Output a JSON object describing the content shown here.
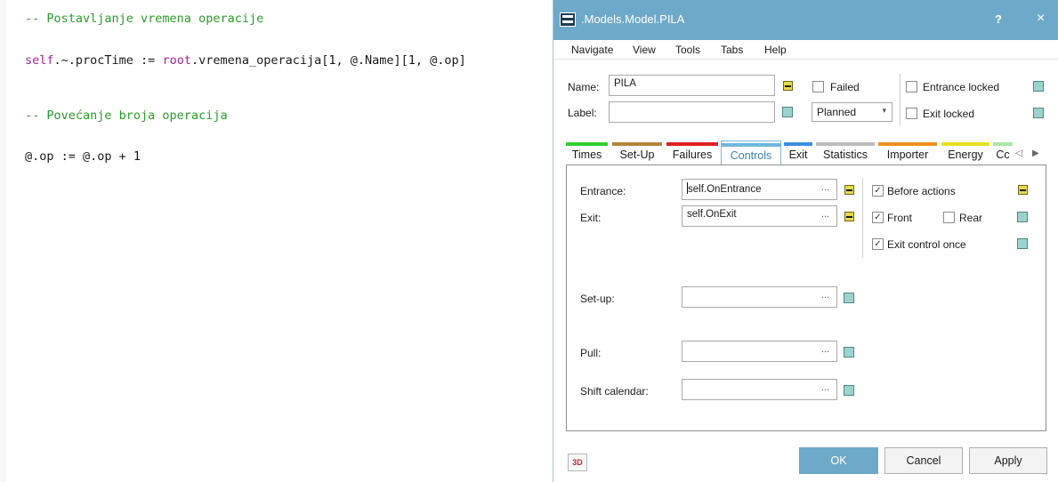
{
  "editor": {
    "lines": [
      {
        "text": "-- Postavljanje vremena operacije"
      },
      {
        "kw1": "self",
        "p1": ".~.procTime := ",
        "kw2": "root",
        "p2": ".vremena_operacija[1, @.Name][1, @.op]"
      },
      {
        "text": "-- Povećanje broja operacija"
      },
      {
        "text": "@.op := @.op + 1"
      }
    ]
  },
  "window": {
    "title": ".Models.Model.PILA",
    "help": "?",
    "close": "×"
  },
  "menu": [
    "Navigate",
    "View",
    "Tools",
    "Tabs",
    "Help"
  ],
  "header": {
    "name_label": "Name:",
    "name_value": "PILA",
    "label_label": "Label:",
    "label_value": "",
    "failed_label": "Failed",
    "failed_checked": false,
    "status_value": "Planned",
    "entrance_locked_label": "Entrance locked",
    "entrance_locked_checked": false,
    "exit_locked_label": "Exit locked",
    "exit_locked_checked": false
  },
  "tabs": [
    {
      "label": "Times",
      "color": "#2fd12f"
    },
    {
      "label": "Set-Up",
      "color": "#b5843a"
    },
    {
      "label": "Failures",
      "color": "#e02020"
    },
    {
      "label": "Controls",
      "color": "#6fb7df",
      "active": true
    },
    {
      "label": "Exit",
      "color": "#3a8ee0"
    },
    {
      "label": "Statistics",
      "color": "#bcbcbc"
    },
    {
      "label": "Importer",
      "color": "#f09020"
    },
    {
      "label": "Energy",
      "color": "#e6e020"
    },
    {
      "label": "Cc",
      "color": "#a8e6a8"
    }
  ],
  "controls": {
    "entrance_label": "Entrance:",
    "entrance_value": "self.OnEntrance",
    "exit_label": "Exit:",
    "exit_value": "self.OnExit",
    "setup_label": "Set-up:",
    "setup_value": "",
    "pull_label": "Pull:",
    "pull_value": "",
    "shift_calendar_label": "Shift calendar:",
    "shift_calendar_value": "",
    "dots": "...",
    "before_actions_label": "Before actions",
    "before_actions_checked": true,
    "front_label": "Front",
    "front_checked": true,
    "rear_label": "Rear",
    "rear_checked": false,
    "exit_control_once_label": "Exit control once",
    "exit_control_once_checked": true
  },
  "footer": {
    "btn_3d": "3D",
    "ok": "OK",
    "cancel": "Cancel",
    "apply": "Apply"
  },
  "colors": {
    "titlebar": "#6fa9c9",
    "comment": "#2a9a2a",
    "keyword": "#b02093",
    "icon_yellow": "#e7da48",
    "icon_teal": "#9dd3cf"
  }
}
